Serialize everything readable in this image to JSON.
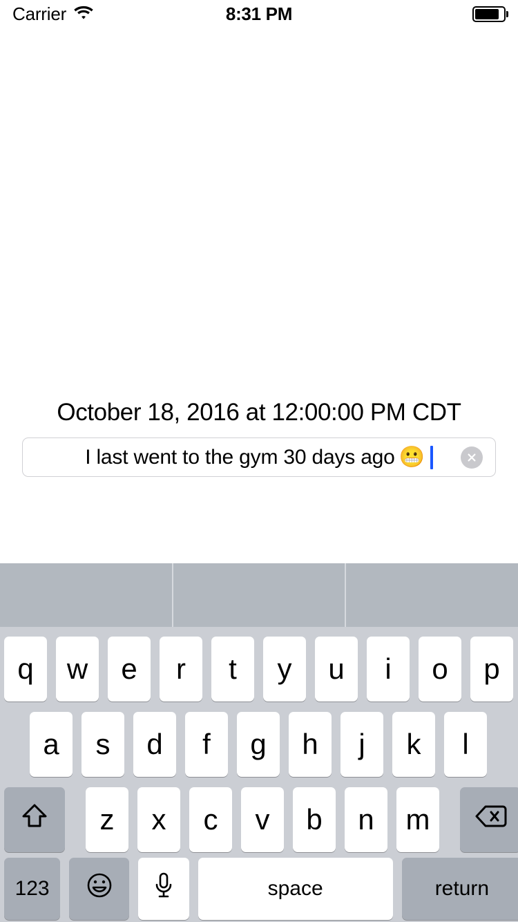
{
  "status_bar": {
    "carrier": "Carrier",
    "wifi_icon": "wifi-icon",
    "time": "8:31 PM",
    "battery_icon": "battery-full-icon"
  },
  "content": {
    "date_label": "October 18, 2016 at 12:00:00 PM CDT",
    "text_field": {
      "value": "I last went to the gym 30 days ago",
      "emoji": "😬",
      "placeholder": "",
      "clear_icon": "clear-circle-icon",
      "caret_color": "#1a57ff"
    }
  },
  "predictive_bar": {
    "slots": [
      "",
      "",
      ""
    ]
  },
  "keyboard": {
    "row1": [
      "q",
      "w",
      "e",
      "r",
      "t",
      "y",
      "u",
      "i",
      "o",
      "p"
    ],
    "row2": [
      "a",
      "s",
      "d",
      "f",
      "g",
      "h",
      "j",
      "k",
      "l"
    ],
    "row3": {
      "shift_icon": "shift-arrow-icon",
      "letters": [
        "z",
        "x",
        "c",
        "v",
        "b",
        "n",
        "m"
      ],
      "delete_icon": "delete-backspace-icon"
    },
    "row4": {
      "numbers_label": "123",
      "emoji_icon": "smiley-face-icon",
      "mic_icon": "microphone-icon",
      "space_label": "space",
      "return_label": "return"
    }
  },
  "colors": {
    "keyboard_background": "#cbced4",
    "predictive_background": "#b2b8bf",
    "key_white": "#ffffff",
    "key_gray": "#a7adb6",
    "caret_blue": "#1a57ff"
  }
}
